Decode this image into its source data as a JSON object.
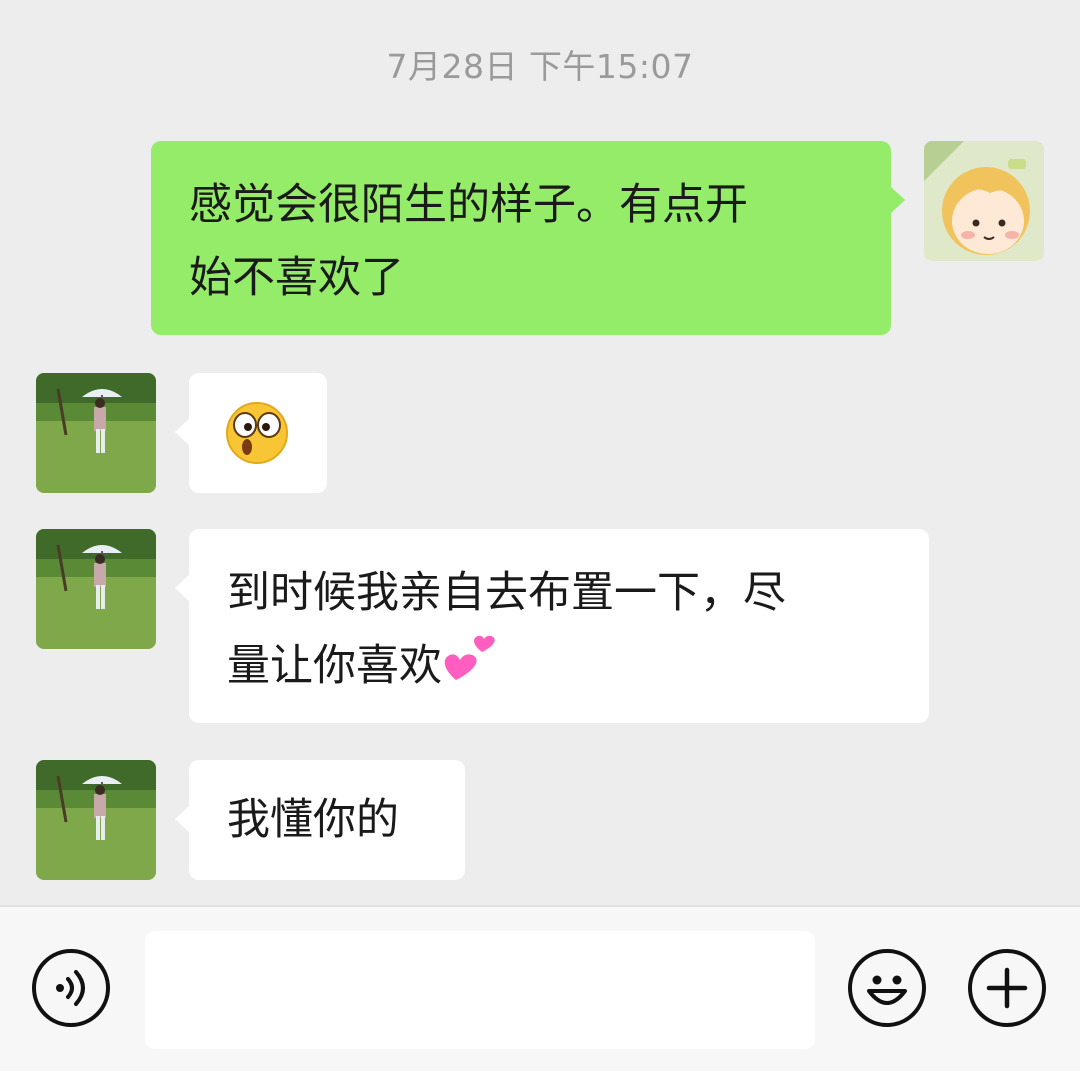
{
  "timestamp": "7月28日 下午15:07",
  "messages": [
    {
      "side": "me",
      "lines": [
        "感觉会很陌生的样子。有点开",
        "始不喜欢了"
      ]
    },
    {
      "side": "them",
      "emoji": "surprised-face-emoji"
    },
    {
      "side": "them",
      "lines": [
        "到时候我亲自去布置一下，尽",
        "量让你喜欢"
      ],
      "trailing_emoji": "two-hearts-emoji"
    },
    {
      "side": "them",
      "lines": [
        "我懂你的"
      ]
    }
  ],
  "input": {
    "placeholder": "",
    "value": ""
  },
  "icons": {
    "voice": "voice-input-icon",
    "emoji": "emoji-button-icon",
    "more": "plus-more-icon"
  },
  "colors": {
    "background": "#ededed",
    "my_bubble": "#95ec69",
    "their_bubble": "#ffffff",
    "timestamp": "#9a9a9a"
  }
}
